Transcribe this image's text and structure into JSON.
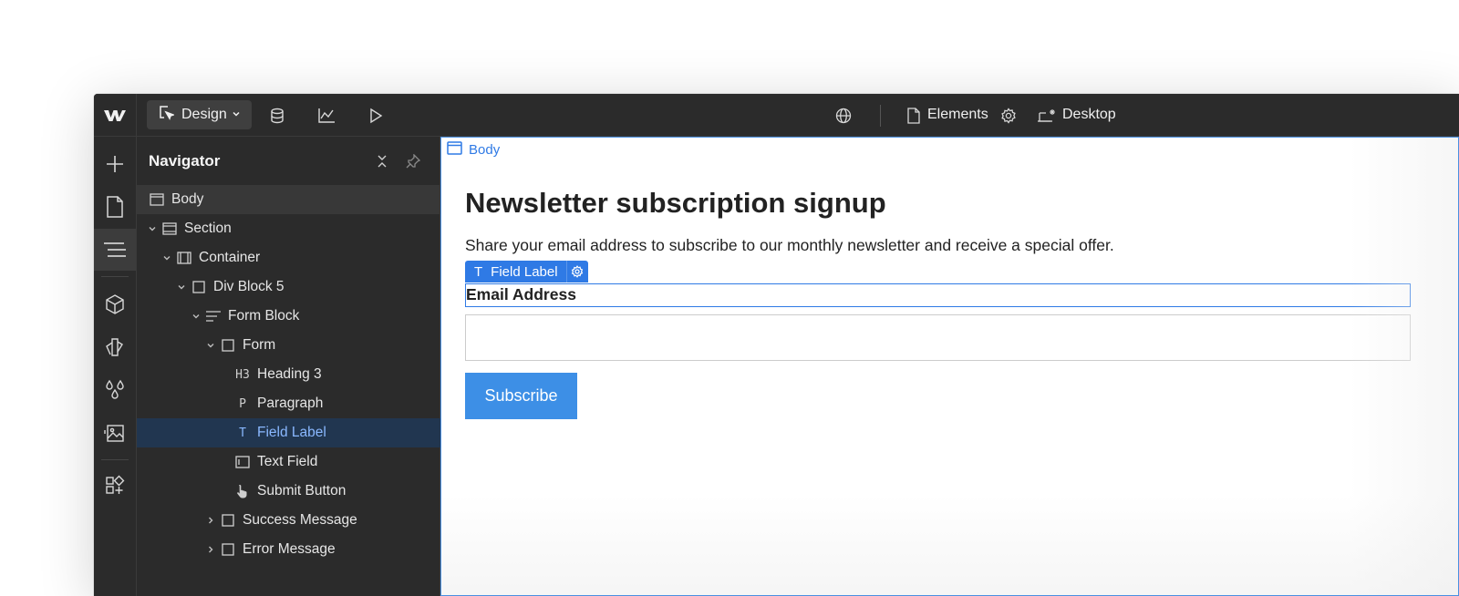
{
  "toolbar": {
    "mode_label": "Design",
    "elements_label": "Elements",
    "breakpoint_label": "Desktop",
    "icons": [
      "webflow-logo-icon",
      "cursor-icon",
      "chevron-down-icon",
      "database-icon",
      "analytics-icon",
      "play-icon",
      "globe-icon",
      "page-icon",
      "gear-icon",
      "desktop-icon"
    ]
  },
  "rail": {
    "icons": [
      "add-icon",
      "pages-icon",
      "navigator-icon",
      "components-icon",
      "style-selector-icon",
      "variables-icon",
      "assets-icon",
      "apps-icon"
    ],
    "active": "navigator-icon"
  },
  "navigator": {
    "title": "Navigator",
    "items": [
      {
        "label": "Body",
        "icon": "body-icon",
        "glyph": "",
        "expanded": null,
        "selected": false
      },
      {
        "label": "Section",
        "icon": "section-icon",
        "glyph": "",
        "expanded": true,
        "selected": false
      },
      {
        "label": "Container",
        "icon": "container-icon",
        "glyph": "",
        "expanded": true,
        "selected": false
      },
      {
        "label": "Div Block 5",
        "icon": "div-block-icon",
        "glyph": "",
        "expanded": true,
        "selected": false
      },
      {
        "label": "Form Block",
        "icon": "form-block-icon",
        "glyph": "",
        "expanded": true,
        "selected": false
      },
      {
        "label": "Form",
        "icon": "form-icon",
        "glyph": "",
        "expanded": true,
        "selected": false
      },
      {
        "label": "Heading 3",
        "icon": "heading-icon",
        "glyph": "H3",
        "expanded": null,
        "selected": false
      },
      {
        "label": "Paragraph",
        "icon": "paragraph-icon",
        "glyph": "P",
        "expanded": null,
        "selected": false
      },
      {
        "label": "Field Label",
        "icon": "text-icon",
        "glyph": "T",
        "expanded": null,
        "selected": true
      },
      {
        "label": "Text Field",
        "icon": "text-field-icon",
        "glyph": "",
        "expanded": null,
        "selected": false
      },
      {
        "label": "Submit Button",
        "icon": "pointer-icon",
        "glyph": "",
        "expanded": null,
        "selected": false
      },
      {
        "label": "Success Message",
        "icon": "div-block-icon",
        "glyph": "",
        "expanded": false,
        "selected": false
      },
      {
        "label": "Error Message",
        "icon": "div-block-icon",
        "glyph": "",
        "expanded": false,
        "selected": false
      }
    ]
  },
  "canvas": {
    "body_tag": "Body",
    "heading": "Newsletter subscription signup",
    "paragraph": "Share your email address to subscribe to our monthly newsletter and receive a special offer.",
    "selection_badge": {
      "glyph": "T",
      "label": "Field Label"
    },
    "field_label": "Email Address",
    "text_field": {
      "value": "",
      "placeholder": ""
    },
    "submit_label": "Subscribe"
  },
  "colors": {
    "accent": "#2f7ae5",
    "selected_row_bg": "#213650",
    "selected_row_text": "#8ab8ff",
    "submit_bg": "#3d8fe6",
    "panel_bg": "#2b2b2b"
  }
}
